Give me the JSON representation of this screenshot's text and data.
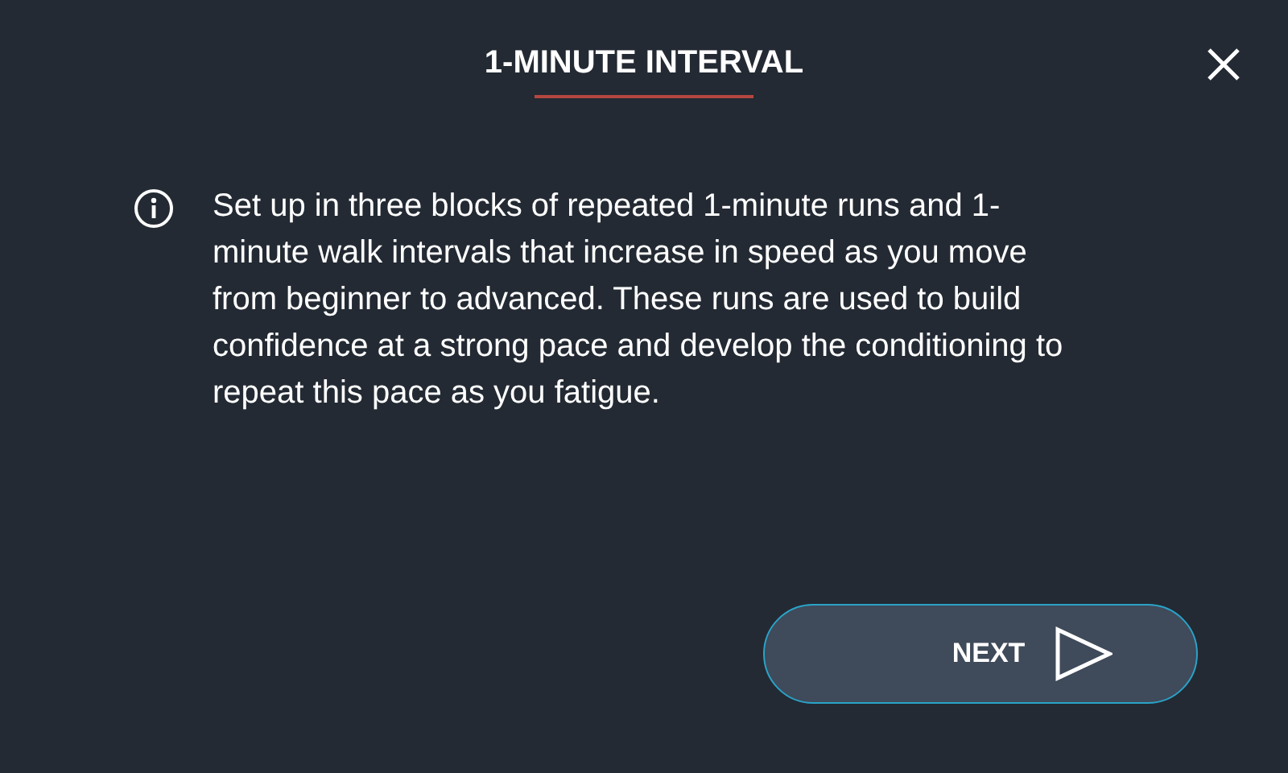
{
  "dialog": {
    "title": "1-MINUTE INTERVAL",
    "description": "Set up in three blocks of repeated 1-minute runs and 1-minute walk intervals that increase in speed as you move from beginner to advanced. These runs are used to build confidence at a strong pace and develop the conditioning to repeat this pace as you fatigue.",
    "next_button": "NEXT"
  }
}
